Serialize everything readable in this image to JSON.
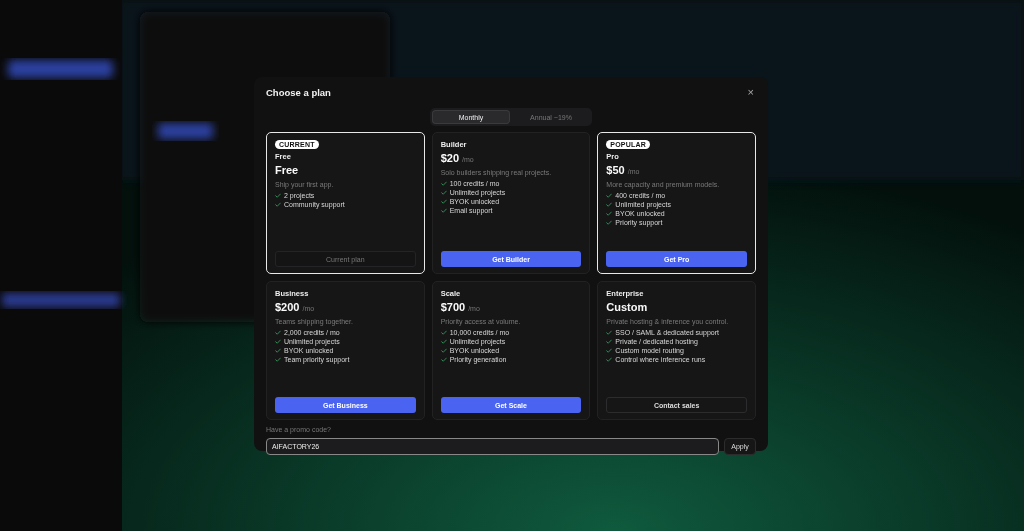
{
  "dialog": {
    "title": "Choose a plan",
    "close": "×"
  },
  "billing_tabs": [
    {
      "label": "Monthly",
      "selected": true
    },
    {
      "label": "Annual",
      "discount": "−19%",
      "selected": false
    }
  ],
  "plans": [
    {
      "badge": "CURRENT",
      "name": "Free",
      "price": "Free",
      "tagline": "Ship your first app.",
      "features": [
        "2 projects",
        "Community support"
      ],
      "button": {
        "label": "Current plan",
        "kind": "current"
      },
      "highlighted": true
    },
    {
      "name": "Builder",
      "price": "$20",
      "period": "/mo",
      "tagline": "Solo builders shipping real projects.",
      "features": [
        "100 credits / mo",
        "Unlimited projects",
        "BYOK unlocked",
        "Email support"
      ],
      "button": {
        "label": "Get Builder",
        "kind": "primary"
      },
      "highlighted": false
    },
    {
      "badge": "POPULAR",
      "name": "Pro",
      "price": "$50",
      "period": "/mo",
      "tagline": "More capacity and premium models.",
      "features": [
        "400 credits / mo",
        "Unlimited projects",
        "BYOK unlocked",
        "Priority support"
      ],
      "button": {
        "label": "Get Pro",
        "kind": "primary"
      },
      "highlighted": true
    },
    {
      "name": "Business",
      "price": "$200",
      "period": "/mo",
      "tagline": "Teams shipping together.",
      "features": [
        "2,000 credits / mo",
        "Unlimited projects",
        "BYOK unlocked",
        "Team priority support"
      ],
      "button": {
        "label": "Get Business",
        "kind": "primary"
      },
      "highlighted": false
    },
    {
      "name": "Scale",
      "price": "$700",
      "period": "/mo",
      "tagline": "Priority access at volume.",
      "features": [
        "10,000 credits / mo",
        "Unlimited projects",
        "BYOK unlocked",
        "Priority generation"
      ],
      "button": {
        "label": "Get Scale",
        "kind": "primary"
      },
      "highlighted": false
    },
    {
      "name": "Enterprise",
      "price": "Custom",
      "tagline": "Private hosting & inference you control.",
      "features": [
        "SSO / SAML & dedicated support",
        "Private / dedicated hosting",
        "Custom model routing",
        "Control where inference runs"
      ],
      "button": {
        "label": "Contact sales",
        "kind": "secondary"
      },
      "highlighted": false
    }
  ],
  "promo": {
    "label": "Have a promo code?",
    "value": "AIFACTORY26",
    "button": "Apply"
  }
}
